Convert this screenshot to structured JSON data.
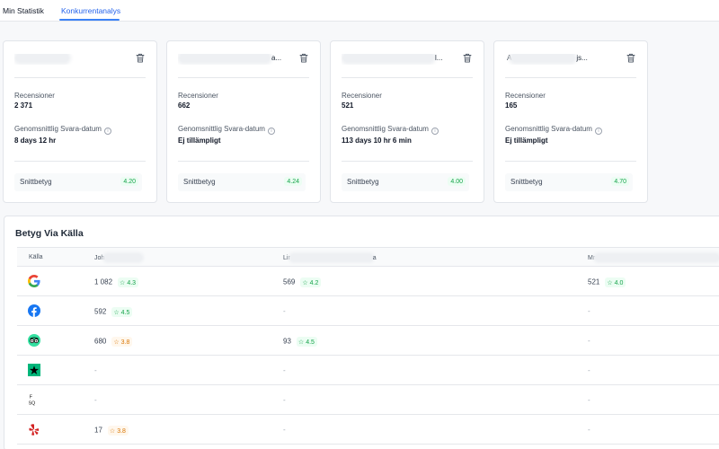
{
  "tabs": [
    "Min Statistik",
    "Konkurrentanalys"
  ],
  "active_tab": "Konkurrentanalys",
  "labels": {
    "recensioner": "Recensioner",
    "genomsnitt": "Genomsnittlig Svara-datum",
    "snittbetyg": "Snittbetyg",
    "info": "i"
  },
  "cards": [
    {
      "name_prefix": "",
      "name_suffix": "",
      "recensioner": "2 371",
      "svara": "8 days 12 hr",
      "snittbetyg": "4.20"
    },
    {
      "name_prefix": "",
      "name_suffix": "a...",
      "recensioner": "662",
      "svara": "Ej tillämpligt",
      "snittbetyg": "4.24"
    },
    {
      "name_prefix": "",
      "name_suffix": "l...",
      "recensioner": "521",
      "svara": "113 days 10 hr 6 min",
      "snittbetyg": "4.00"
    },
    {
      "name_prefix": "A",
      "name_suffix": "js...",
      "recensioner": "165",
      "svara": "Ej tillämpligt",
      "snittbetyg": "4.70"
    }
  ],
  "section": {
    "title": "Betyg Via Källa",
    "headers": {
      "kalla": "Källa",
      "col1_prefix": "Joh",
      "col1_suffix": "",
      "col2_prefix": "Lir",
      "col2_suffix": "a",
      "col3_prefix": "Mr",
      "col3_suffix": ""
    },
    "rows": [
      {
        "source": "google-logo",
        "c1": "1 082",
        "b1": "4.3",
        "b1c": "green",
        "c2": "569",
        "b2": "4.2",
        "b2c": "green",
        "c3": "521",
        "b3": "4.0",
        "b3c": "green"
      },
      {
        "source": "facebook-logo",
        "c1": "592",
        "b1": "4.5",
        "b1c": "green",
        "c2": "-",
        "b2": "",
        "b2c": "",
        "c3": "-",
        "b3": "",
        "b3c": ""
      },
      {
        "source": "tripadvisor-logo",
        "c1": "680",
        "b1": "3.8",
        "b1c": "orange",
        "c2": "93",
        "b2": "4.5",
        "b2c": "green",
        "c3": "-",
        "b3": "",
        "b3c": ""
      },
      {
        "source": "trustpilot-logo",
        "c1": "-",
        "b1": "",
        "b1c": "",
        "c2": "-",
        "b2": "",
        "b2c": "",
        "c3": "-",
        "b3": "",
        "b3c": ""
      },
      {
        "source": "foursquare-logo",
        "c1": "-",
        "b1": "",
        "b1c": "",
        "c2": "-",
        "b2": "",
        "b2c": "",
        "c3": "-",
        "b3": "",
        "b3c": ""
      },
      {
        "source": "yelp-logo",
        "c1": "17",
        "b1": "3.8",
        "b1c": "orange",
        "c2": "-",
        "b2": "",
        "b2c": "",
        "c3": "-",
        "b3": "",
        "b3c": ""
      }
    ]
  },
  "colors": {
    "accent": "#2563eb",
    "rating_good": "#16a34a",
    "rating_mid": "#d97706",
    "border": "#e2e5ea"
  },
  "logo_text": {
    "foursquare": "F\nSQ"
  }
}
